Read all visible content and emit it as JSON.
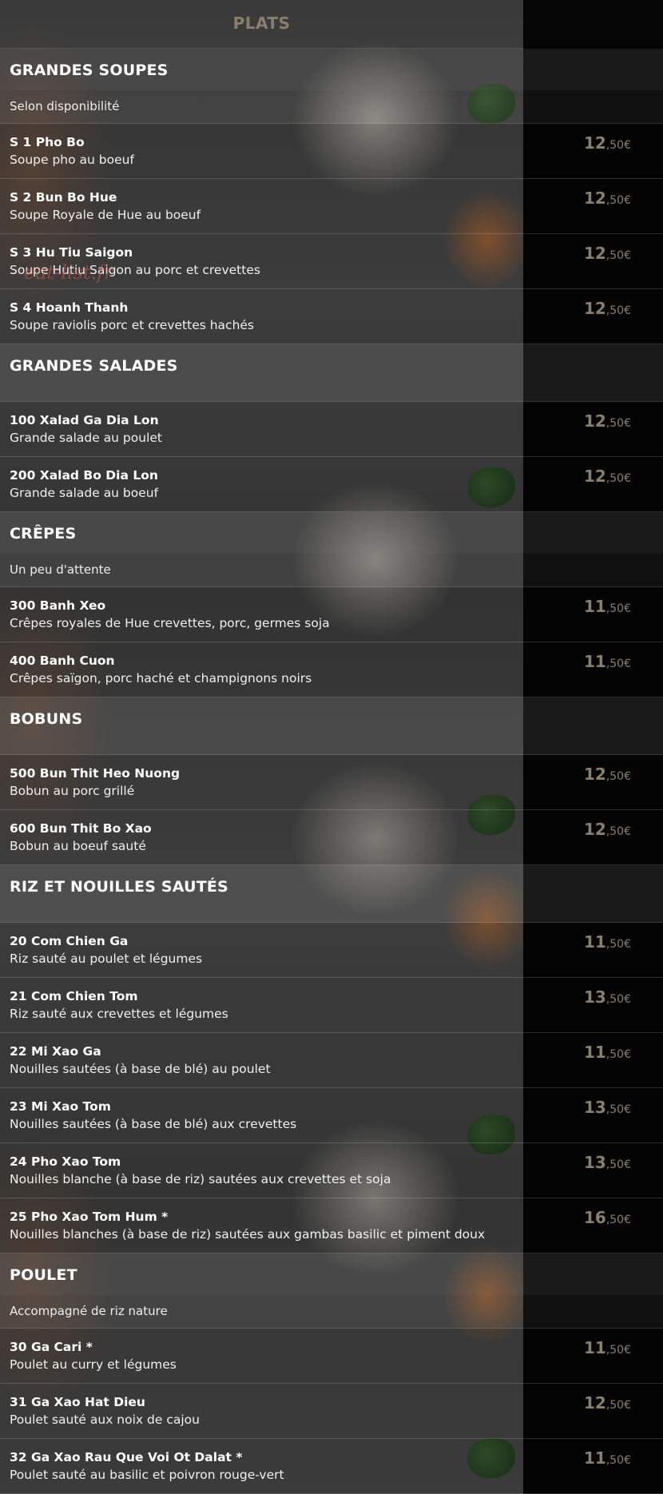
{
  "page_title": "PLATS",
  "watermark": "eat-list.fr",
  "sections": [
    {
      "title": "GRANDES SOUPES",
      "note": "Selon disponibilité",
      "items": [
        {
          "name": "S 1 Pho Bo",
          "desc": "Soupe pho au boeuf",
          "price_int": "12",
          "price_dec": ",50€"
        },
        {
          "name": "S 2 Bun Bo Hue",
          "desc": "Soupe Royale de Hue au boeuf",
          "price_int": "12",
          "price_dec": ",50€"
        },
        {
          "name": "S 3 Hu Tiu Saigon",
          "desc": "Soupe Hutiu Saigon au porc et crevettes",
          "price_int": "12",
          "price_dec": ",50€"
        },
        {
          "name": "S 4 Hoanh Thanh",
          "desc": "Soupe raviolis porc et crevettes hachés",
          "price_int": "12",
          "price_dec": ",50€"
        }
      ]
    },
    {
      "title": "GRANDES SALADES",
      "note": "",
      "items": [
        {
          "name": "100 Xalad Ga Dia Lon",
          "desc": "Grande salade au poulet",
          "price_int": "12",
          "price_dec": ",50€"
        },
        {
          "name": "200 Xalad Bo Dia Lon",
          "desc": "Grande salade au boeuf",
          "price_int": "12",
          "price_dec": ",50€"
        }
      ]
    },
    {
      "title": "CRÊPES",
      "note": "Un peu d'attente",
      "items": [
        {
          "name": "300 Banh Xeo",
          "desc": "Crêpes royales de Hue crevettes, porc, germes soja",
          "price_int": "11",
          "price_dec": ",50€"
        },
        {
          "name": "400 Banh Cuon",
          "desc": "Crêpes saïgon, porc haché et champignons noirs",
          "price_int": "11",
          "price_dec": ",50€"
        }
      ]
    },
    {
      "title": "BOBUNS",
      "note": "",
      "items": [
        {
          "name": "500 Bun Thit Heo Nuong",
          "desc": "Bobun au porc grillé",
          "price_int": "12",
          "price_dec": ",50€"
        },
        {
          "name": "600 Bun Thit Bo Xao",
          "desc": "Bobun au boeuf sauté",
          "price_int": "12",
          "price_dec": ",50€"
        }
      ]
    },
    {
      "title": "RIZ ET NOUILLES SAUTÉS",
      "note": "",
      "items": [
        {
          "name": "20 Com Chien Ga",
          "desc": "Riz sauté au poulet et légumes",
          "price_int": "11",
          "price_dec": ",50€"
        },
        {
          "name": "21 Com Chien Tom",
          "desc": "Riz sauté aux crevettes et légumes",
          "price_int": "13",
          "price_dec": ",50€"
        },
        {
          "name": "22 Mi Xao Ga",
          "desc": "Nouilles sautées (à base de blé) au poulet",
          "price_int": "11",
          "price_dec": ",50€"
        },
        {
          "name": "23 Mi Xao Tom",
          "desc": "Nouilles sautées (à base de blé) aux crevettes",
          "price_int": "13",
          "price_dec": ",50€"
        },
        {
          "name": "24 Pho Xao Tom",
          "desc": "Nouilles blanche (à base de riz) sautées aux crevettes et soja",
          "price_int": "13",
          "price_dec": ",50€"
        },
        {
          "name": "25 Pho Xao Tom Hum *",
          "desc": "Nouilles blanches (à base de riz) sautées aux gambas basilic et piment doux",
          "price_int": "16",
          "price_dec": ",50€"
        }
      ]
    },
    {
      "title": "POULET",
      "note": "Accompagné de riz nature",
      "items": [
        {
          "name": "30 Ga Cari *",
          "desc": "Poulet au curry et légumes",
          "price_int": "11",
          "price_dec": ",50€"
        },
        {
          "name": "31 Ga Xao Hat Dieu",
          "desc": "Poulet sauté aux noix de cajou",
          "price_int": "12",
          "price_dec": ",50€"
        },
        {
          "name": "32 Ga Xao Rau Que Voi Ot Dalat *",
          "desc": "Poulet sauté au basilic et poivron rouge-vert",
          "price_int": "11",
          "price_dec": ",50€"
        }
      ]
    }
  ]
}
